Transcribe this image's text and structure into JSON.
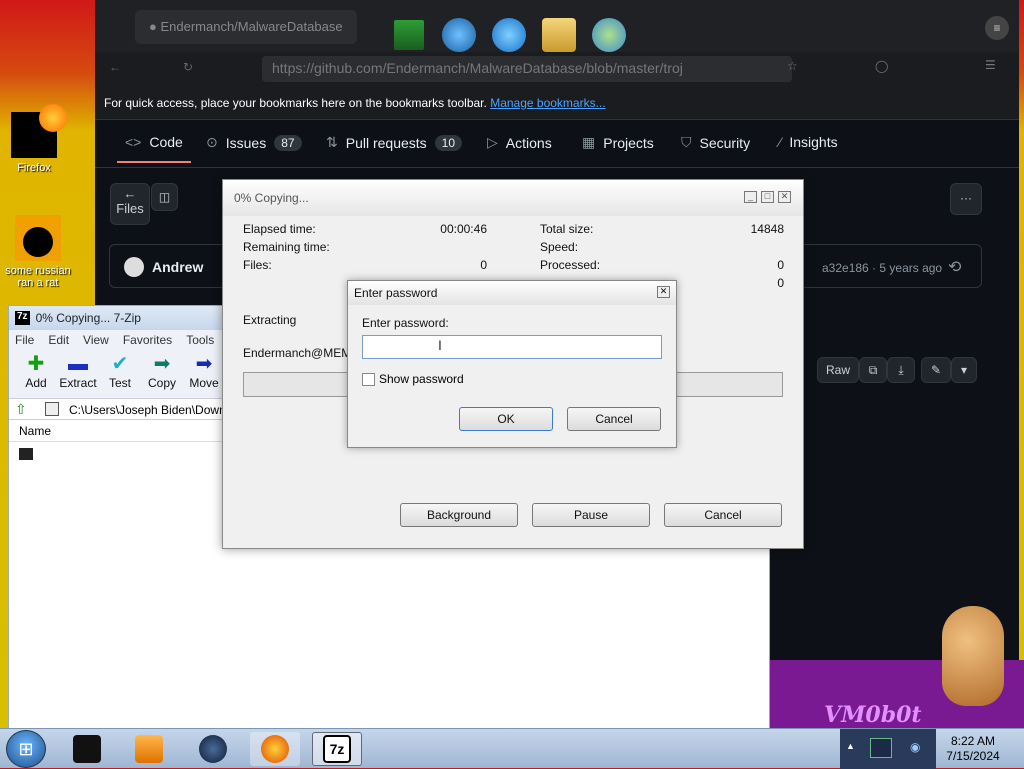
{
  "desktop": {
    "icons": [
      {
        "label": "Firefox"
      },
      {
        "label": "some russian ran a rat"
      }
    ]
  },
  "browser": {
    "tab_title": "Endermanch/MalwareDatabase",
    "url": "https://github.com/Endermanch/MalwareDatabase/blob/master/troj",
    "bookmark_hint": "For quick access, place your bookmarks here on the bookmarks toolbar.",
    "bookmark_link": "Manage bookmarks...",
    "nav": [
      {
        "label": "Code",
        "icon": "code-icon"
      },
      {
        "label": "Issues",
        "count": "87",
        "icon": "issues-icon"
      },
      {
        "label": "Pull requests",
        "count": "10",
        "icon": "pull-request-icon"
      },
      {
        "label": "Actions",
        "icon": "play-icon"
      },
      {
        "label": "Projects",
        "icon": "table-icon"
      },
      {
        "label": "Security",
        "icon": "shield-icon"
      },
      {
        "label": "Insights",
        "icon": "graph-icon"
      }
    ],
    "files_button": "Files",
    "author": "Andrew",
    "commit_info": "a32e186 · 5 years ago",
    "raw_button": "Raw"
  },
  "sevenzip": {
    "title": "0% Copying... 7-Zip",
    "menu": [
      "File",
      "Edit",
      "View",
      "Favorites",
      "Tools"
    ],
    "tools": [
      {
        "label": "Add",
        "icon": "plus-icon",
        "glyph": "✚",
        "color": "#12a012"
      },
      {
        "label": "Extract",
        "icon": "minus-icon",
        "glyph": "▬",
        "color": "#1a30c0"
      },
      {
        "label": "Test",
        "icon": "check-icon",
        "glyph": "✔",
        "color": "#20b0c0"
      },
      {
        "label": "Copy",
        "icon": "copy-arrow-icon",
        "glyph": "➡",
        "color": "#117a66"
      },
      {
        "label": "Move",
        "icon": "move-arrow-icon",
        "glyph": "➡",
        "color": "#1a2ab0"
      }
    ],
    "path": "C:\\Users\\Joseph Biden\\Down",
    "column_name": "Name"
  },
  "copy_dialog": {
    "title": "0% Copying...",
    "elapsed_label": "Elapsed time:",
    "elapsed_value": "00:00:46",
    "remaining_label": "Remaining time:",
    "files_label": "Files:",
    "files_value": "0",
    "total_size_label": "Total size:",
    "total_size_value": "14848",
    "speed_label": "Speed:",
    "processed_label": "Processed:",
    "processed_value": "0",
    "compressed_value": "0",
    "extracting_label": "Extracting",
    "current_file": "Endermanch@MEMZ.",
    "background_button": "Background",
    "pause_button": "Pause",
    "cancel_button": "Cancel"
  },
  "password_dialog": {
    "title": "Enter password",
    "prompt": "Enter password:",
    "value": "",
    "show_password_label": "Show password",
    "show_password_checked": false,
    "ok_button": "OK",
    "cancel_button": "Cancel"
  },
  "overlay": {
    "logo_text": "VM0b0t"
  },
  "taskbar": {
    "time": "8:22 AM",
    "date": "7/15/2024"
  }
}
